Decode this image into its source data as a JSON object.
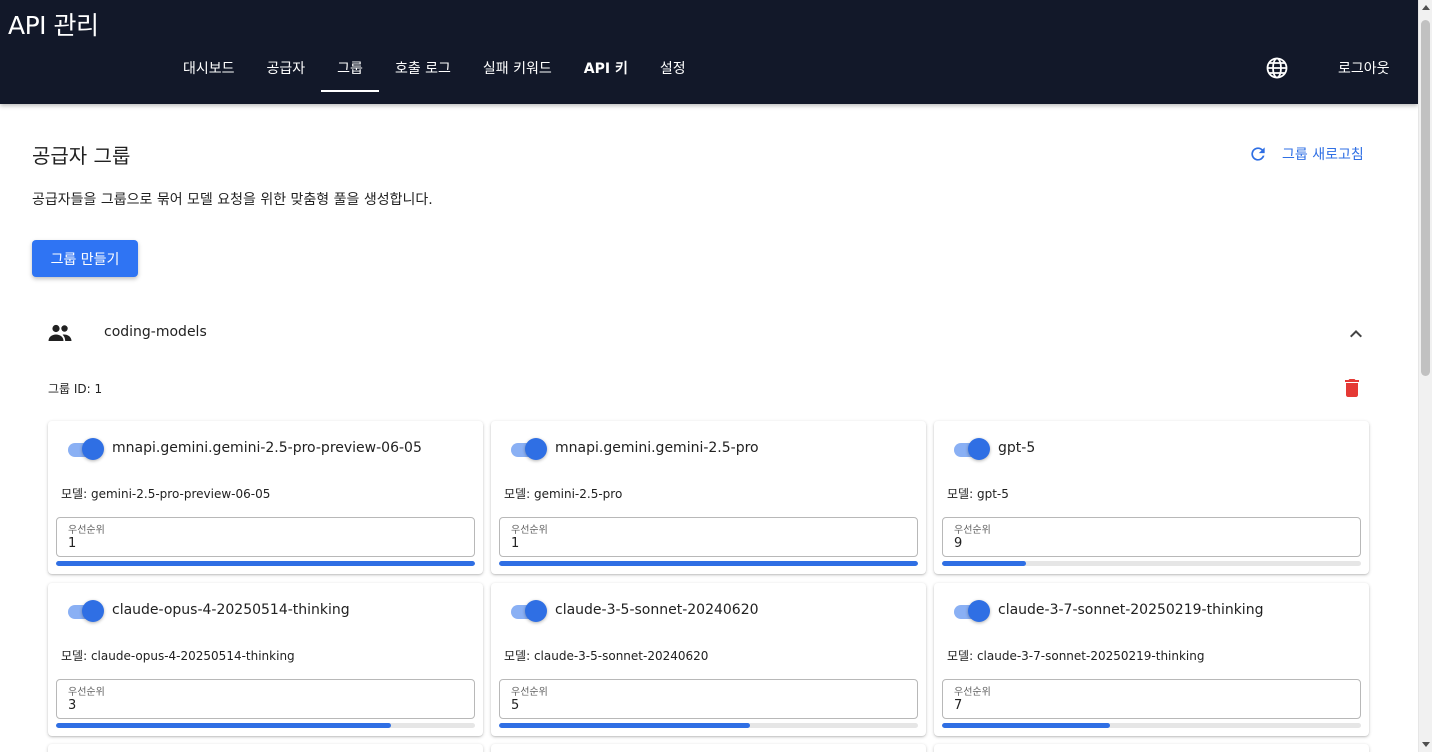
{
  "app": {
    "title": "API 관리"
  },
  "nav": {
    "tabs": [
      {
        "label": "대시보드",
        "active": false
      },
      {
        "label": "공급자",
        "active": false
      },
      {
        "label": "그룹",
        "active": true
      },
      {
        "label": "호출 로그",
        "active": false
      },
      {
        "label": "실패 키워드",
        "active": false
      },
      {
        "label": "API 키",
        "active": false
      },
      {
        "label": "설정",
        "active": false
      }
    ],
    "language_icon": "globe-icon",
    "logout_label": "로그아웃"
  },
  "page": {
    "title": "공급자 그룹",
    "refresh_label": "그룹 새로고침",
    "description": "공급자들을 그룹으로 묶어 모델 요청을 위한 맞춤형 풀을 생성합니다.",
    "create_label": "그룹 만들기"
  },
  "group": {
    "name": "coding-models",
    "id_text": "그룹 ID: 1",
    "expanded": true,
    "model_prefix": "모델: ",
    "priority_label": "우선순위",
    "providers": [
      {
        "name": "mnapi.gemini.gemini-2.5-pro-preview-06-05",
        "model": "gemini-2.5-pro-preview-06-05",
        "priority": "1",
        "enabled": true,
        "priority_fill": 1.0
      },
      {
        "name": "mnapi.gemini.gemini-2.5-pro",
        "model": "gemini-2.5-pro",
        "priority": "1",
        "enabled": true,
        "priority_fill": 1.0
      },
      {
        "name": "gpt-5",
        "model": "gpt-5",
        "priority": "9",
        "enabled": true,
        "priority_fill": 0.2
      },
      {
        "name": "claude-opus-4-20250514-thinking",
        "model": "claude-opus-4-20250514-thinking",
        "priority": "3",
        "enabled": true,
        "priority_fill": 0.8
      },
      {
        "name": "claude-3-5-sonnet-20240620",
        "model": "claude-3-5-sonnet-20240620",
        "priority": "5",
        "enabled": true,
        "priority_fill": 0.6
      },
      {
        "name": "claude-3-7-sonnet-20250219-thinking",
        "model": "claude-3-7-sonnet-20250219-thinking",
        "priority": "7",
        "enabled": true,
        "priority_fill": 0.4
      }
    ]
  },
  "colors": {
    "appbar": "#121829",
    "accent": "#2f6fe4",
    "delete": "#e53935"
  }
}
